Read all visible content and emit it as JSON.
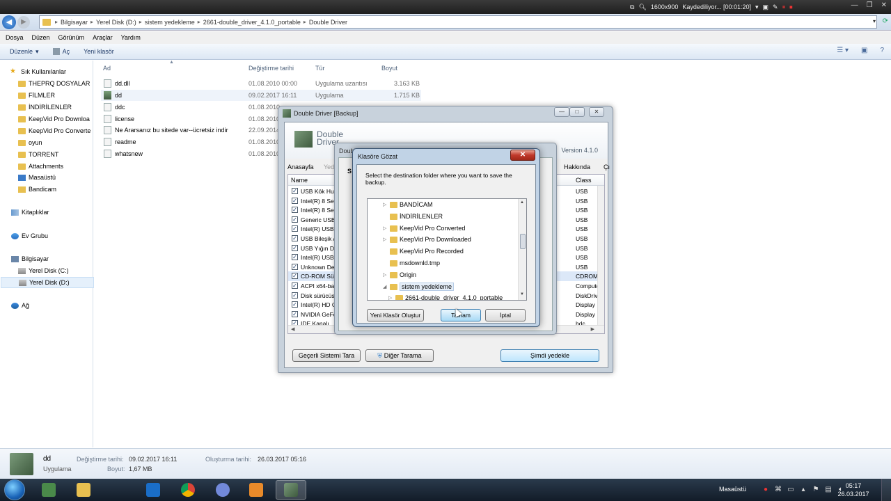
{
  "recorder": {
    "resolution": "1600x900",
    "status": "Kaydediliyor... [00:01:20]"
  },
  "explorer": {
    "breadcrumb": [
      "Bilgisayar",
      "Yerel Disk (D:)",
      "sistem yedekleme",
      "2661-double_driver_4.1.0_portable",
      "Double Driver"
    ],
    "menu": [
      "Dosya",
      "Düzen",
      "Görünüm",
      "Araçlar",
      "Yardım"
    ],
    "toolbar": {
      "organize": "Düzenle",
      "open": "Aç",
      "new_folder": "Yeni klasör"
    },
    "sidebar": {
      "favorites_label": "Sık Kullanılanlar",
      "favorites": [
        "THEPRQ DOSYALAR",
        "FİLMLER",
        "İNDİRİLENLER",
        "KeepVid Pro Downloa",
        "KeepVid Pro Converte",
        "oyun",
        "TORRENT",
        "Attachments",
        "Masaüstü",
        "Bandicam"
      ],
      "libraries": "Kitaplıklar",
      "homegroup": "Ev Grubu",
      "computer": "Bilgisayar",
      "drive_c": "Yerel Disk (C:)",
      "drive_d": "Yerel Disk (D:)",
      "network": "Ağ"
    },
    "columns": {
      "name": "Ad",
      "date": "Değiştirme tarihi",
      "type": "Tür",
      "size": "Boyut"
    },
    "files": [
      {
        "name": "dd.dll",
        "date": "01.08.2010 00:00",
        "type": "Uygulama uzantısı",
        "size": "3.163 KB"
      },
      {
        "name": "dd",
        "date": "09.02.2017 16:11",
        "type": "Uygulama",
        "size": "1.715 KB"
      },
      {
        "name": "ddc",
        "date": "01.08.2010",
        "type": "",
        "size": ""
      },
      {
        "name": "license",
        "date": "01.08.2010",
        "type": "",
        "size": ""
      },
      {
        "name": "Ne Ararsanız bu sitede var--ücretsiz indir",
        "date": "22.09.2014",
        "type": "",
        "size": ""
      },
      {
        "name": "readme",
        "date": "01.08.2010",
        "type": "",
        "size": ""
      },
      {
        "name": "whatsnew",
        "date": "01.08.2010",
        "type": "",
        "size": ""
      }
    ],
    "details": {
      "name": "dd",
      "type": "Uygulama",
      "modified_label": "Değiştirme tarihi:",
      "modified": "09.02.2017 16:11",
      "created_label": "Oluşturma tarihi:",
      "created": "26.03.2017 05:16",
      "size_label": "Boyut:",
      "size": "1,67 MB"
    }
  },
  "double_driver": {
    "title": "Double Driver [Backup]",
    "logo_line1": "Double",
    "logo_line2": "Driver",
    "version": "Version 4.1.0",
    "tabs": {
      "home": "Anasayfa",
      "home_partial": "Yed",
      "about": "Hakkında",
      "exit_partial": "Çı"
    },
    "columns": {
      "name": "Name",
      "class": "Class"
    },
    "drivers": [
      {
        "name": "USB Kök Hub",
        "class": "USB"
      },
      {
        "name": "Intel(R) 8 Serie",
        "class": "USB"
      },
      {
        "name": "Intel(R) 8 Serie",
        "class": "USB"
      },
      {
        "name": "Generic USB Hu",
        "class": "USB"
      },
      {
        "name": "Intel(R) USB 3.",
        "class": "USB"
      },
      {
        "name": "USB Bileşik Ayg",
        "class": "USB"
      },
      {
        "name": "USB Yığın Depo",
        "class": "USB"
      },
      {
        "name": "Intel(R) USB 3.",
        "class": "USB"
      },
      {
        "name": "Unknown Devic",
        "class": "USB"
      },
      {
        "name": "CD-ROM Sürücü",
        "class": "CDROM"
      },
      {
        "name": "ACPI x64-base",
        "class": "Computer"
      },
      {
        "name": "Disk sürücüsü",
        "class": "DiskDrive"
      },
      {
        "name": "Intel(R) HD Gra",
        "class": "Display"
      },
      {
        "name": "NVIDIA GeForc",
        "class": "Display"
      },
      {
        "name": "IDE Kanalı",
        "class": "hdc"
      }
    ],
    "buttons": {
      "scan_current": "Geçerli Sistemi Tara",
      "other_scan": "Diğer Tarama",
      "backup_now": "Şimdi yedekle"
    },
    "inner_title_partial": "Double",
    "inner_partial_s": "S"
  },
  "folder_dialog": {
    "title": "Klasöre Gözat",
    "close": "✕",
    "description": "Select the destination folder where you want to save the backup.",
    "tree": [
      {
        "label": "BANDİCAM",
        "twisty": "▷",
        "indent": 0
      },
      {
        "label": "İNDİRİLENLER",
        "twisty": "",
        "indent": 0
      },
      {
        "label": "KeepVid Pro Converted",
        "twisty": "▷",
        "indent": 0
      },
      {
        "label": "KeepVid Pro Downloaded",
        "twisty": "▷",
        "indent": 0
      },
      {
        "label": "KeepVid Pro Recorded",
        "twisty": "",
        "indent": 0
      },
      {
        "label": "msdownld.tmp",
        "twisty": "",
        "indent": 0
      },
      {
        "label": "Origin",
        "twisty": "▷",
        "indent": 0
      },
      {
        "label": "sistem yedekleme",
        "twisty": "◢",
        "indent": 0
      },
      {
        "label": "2661-double_driver_4.1.0_portable",
        "twisty": "▷",
        "indent": 1
      }
    ],
    "buttons": {
      "new_folder": "Yeni Klasör Oluştur",
      "ok": "Tamam",
      "cancel": "İptal"
    }
  },
  "taskbar": {
    "desktop_label": "Masaüstü",
    "time": "05:17",
    "date": "26.03.2017"
  }
}
